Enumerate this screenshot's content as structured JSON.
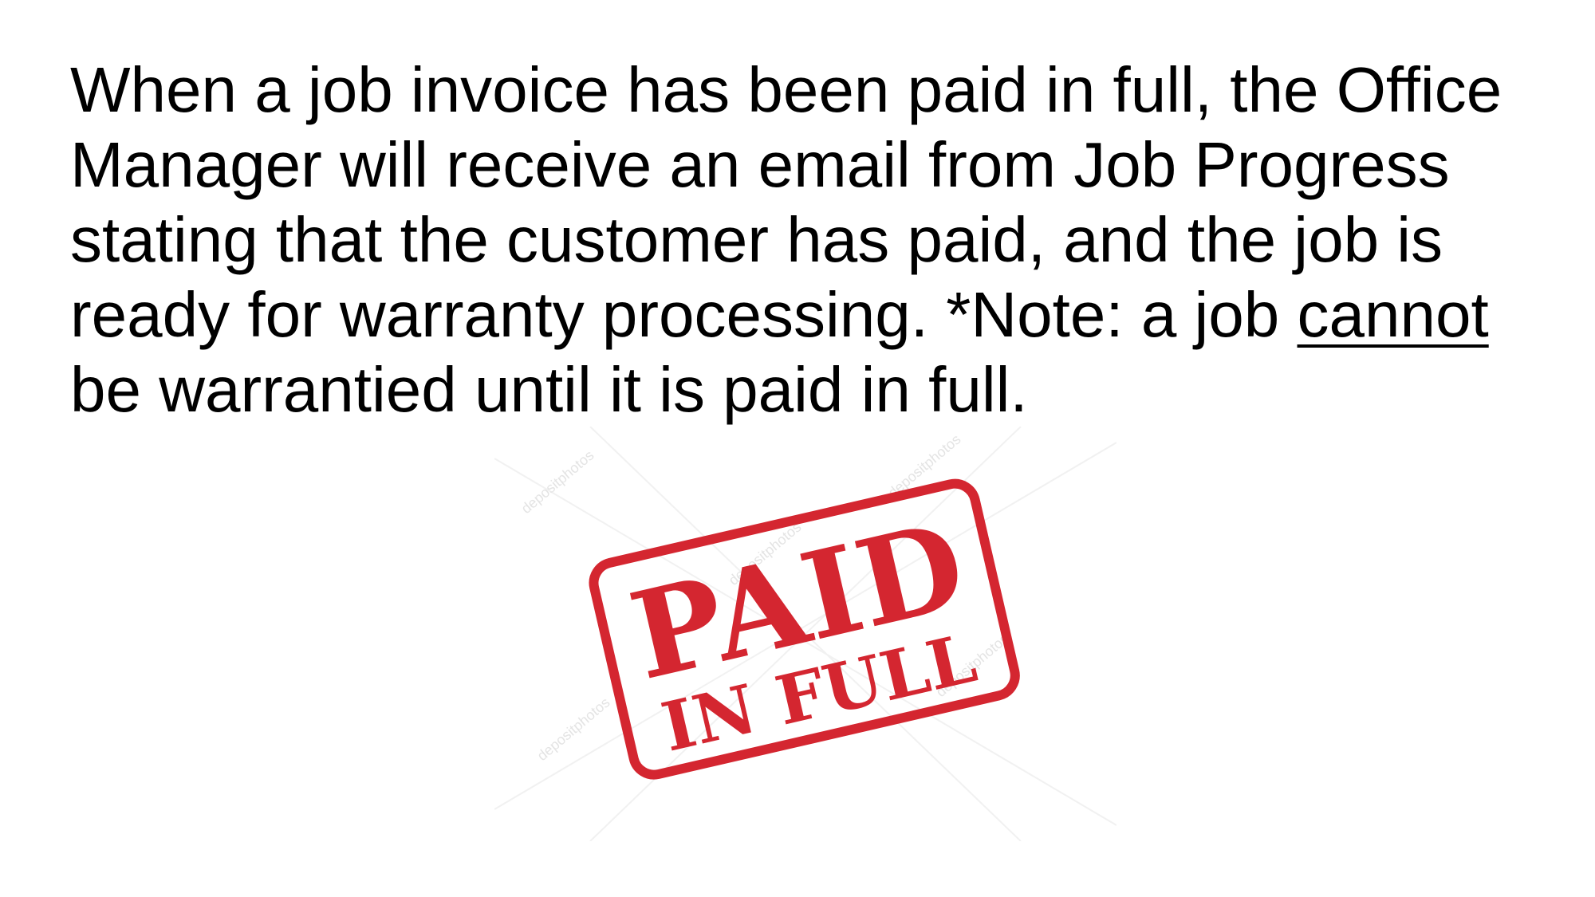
{
  "paragraph": {
    "part1": "When a job invoice has been paid in full, the Office Manager will receive an email from Job Progress stating that the customer has paid, and the job is ready for warranty processing. *Note: a job ",
    "emphasis": "cannot",
    "part2": " be warrantied until it is paid in full."
  },
  "stamp": {
    "line1": "PAID",
    "line2": "IN FULL",
    "watermark": "depositphotos",
    "color": "#d42630"
  },
  "colors": {
    "text": "#000000",
    "background": "#ffffff"
  }
}
